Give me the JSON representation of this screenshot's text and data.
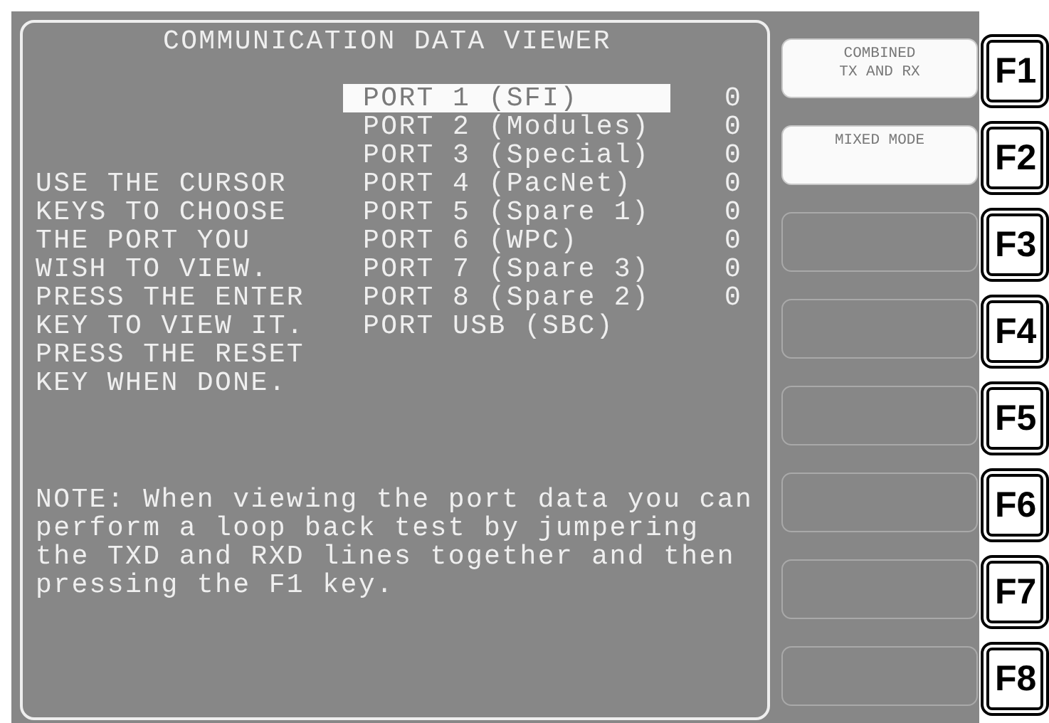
{
  "title": "COMMUNICATION DATA VIEWER",
  "ports": [
    {
      "label": "PORT 1 (SFI)",
      "count": "0",
      "selected": true
    },
    {
      "label": "PORT 2 (Modules)",
      "count": "0",
      "selected": false
    },
    {
      "label": "PORT 3 (Special)",
      "count": "0",
      "selected": false
    },
    {
      "label": "PORT 4 (PacNet)",
      "count": "0",
      "selected": false
    },
    {
      "label": "PORT 5 (Spare 1)",
      "count": "0",
      "selected": false
    },
    {
      "label": "PORT 6 (WPC)",
      "count": "0",
      "selected": false
    },
    {
      "label": "PORT 7 (Spare 3)",
      "count": "0",
      "selected": false
    },
    {
      "label": "PORT 8 (Spare 2)",
      "count": "0",
      "selected": false
    },
    {
      "label": "PORT USB (SBC)",
      "selected": false
    }
  ],
  "instructions": [
    "USE THE CURSOR",
    "KEYS TO CHOOSE",
    "THE PORT YOU",
    "WISH TO VIEW.",
    "PRESS THE ENTER",
    "KEY TO VIEW IT.",
    "PRESS THE RESET",
    "KEY WHEN DONE."
  ],
  "note": [
    "NOTE: When viewing the port data you can",
    "perform a loop back test by jumpering",
    "the TXD and RXD lines together and then",
    "pressing the F1 key."
  ],
  "softkeys": [
    {
      "kind": "labeled",
      "lines": [
        "COMBINED",
        "TX AND RX"
      ]
    },
    {
      "kind": "labeled",
      "lines": [
        "MIXED MODE"
      ]
    },
    {
      "kind": "blank"
    },
    {
      "kind": "blank"
    },
    {
      "kind": "blank"
    },
    {
      "kind": "blank"
    },
    {
      "kind": "blank"
    },
    {
      "kind": "blank"
    }
  ],
  "function_keys": [
    "F1",
    "F2",
    "F3",
    "F4",
    "F5",
    "F6",
    "F7",
    "F8"
  ]
}
